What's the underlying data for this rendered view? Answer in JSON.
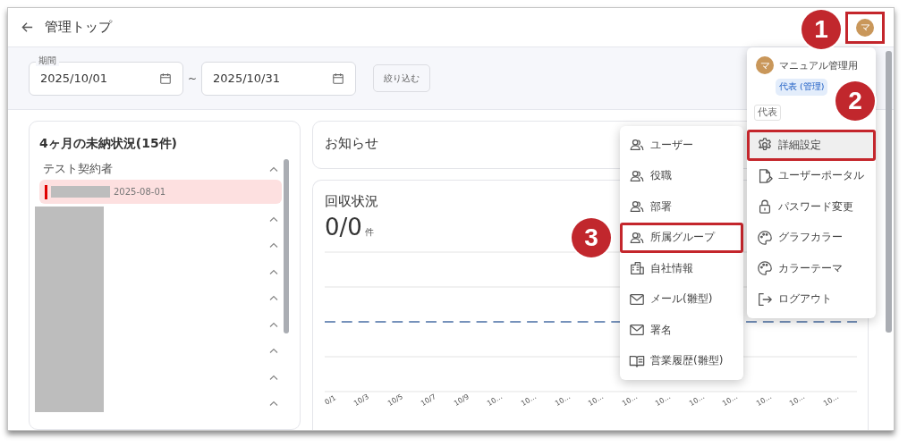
{
  "header": {
    "title": "管理トップ",
    "avatar_initial": "マ",
    "avatar_annotated": true
  },
  "filter": {
    "period_label": "期間",
    "start_date": "2025/10/01",
    "separator": "~",
    "end_date": "2025/10/31",
    "filter_button": "絞り込む"
  },
  "overdue_card": {
    "title": "4ヶ月の未納状況(15件)",
    "groups": [
      {
        "name": "テスト契約者",
        "expanded": true,
        "entries": [
          {
            "date": "2025-08-01",
            "flagged": true
          }
        ]
      }
    ],
    "hidden_groups": [
      {
        "expanded": true
      },
      {
        "expanded": true
      },
      {
        "expanded": true
      },
      {
        "expanded": true
      },
      {
        "expanded": true
      },
      {
        "expanded": true
      },
      {
        "expanded": true
      },
      {
        "expanded": true
      }
    ]
  },
  "notice_card": {
    "title": "お知らせ"
  },
  "collection_card": {
    "title": "回収状況",
    "value": "0/0",
    "unit": "件",
    "x_labels": [
      "0/1",
      "10/3",
      "10/5",
      "10/7",
      "10/9",
      "10…",
      "10…",
      "10…",
      "10…",
      "10…",
      "10…",
      "10…",
      "10…",
      "10…",
      "10…",
      "10…"
    ]
  },
  "submenu": {
    "items": [
      {
        "label": "ユーザー",
        "kind": "people",
        "annotated": false
      },
      {
        "label": "役職",
        "kind": "people",
        "annotated": false
      },
      {
        "label": "部署",
        "kind": "people",
        "annotated": false
      },
      {
        "label": "所属グループ",
        "kind": "people",
        "annotated": true
      },
      {
        "label": "自社情報",
        "kind": "building",
        "annotated": false
      },
      {
        "label": "メール(雛型)",
        "kind": "mail",
        "annotated": false
      },
      {
        "label": "署名",
        "kind": "mail",
        "annotated": false
      },
      {
        "label": "営業履歴(雛型)",
        "kind": "book",
        "annotated": false
      }
    ]
  },
  "user_menu": {
    "avatar_initial": "マ",
    "name": "マニュアル管理用",
    "role_chip": "代表 (管理)",
    "role_select": "代表",
    "items": [
      {
        "label": "詳細設定",
        "kind": "gear",
        "selected": true,
        "annotated": true
      },
      {
        "label": "ユーザーポータル",
        "kind": "document",
        "selected": false,
        "annotated": false
      },
      {
        "label": "パスワード変更",
        "kind": "lock",
        "selected": false,
        "annotated": false
      },
      {
        "label": "グラフカラー",
        "kind": "palette",
        "selected": false,
        "annotated": false
      },
      {
        "label": "カラーテーマ",
        "kind": "palette",
        "selected": false,
        "annotated": false
      },
      {
        "label": "ログアウト",
        "kind": "logout",
        "selected": false,
        "annotated": false
      }
    ]
  },
  "callouts": [
    {
      "number": "1"
    },
    {
      "number": "2"
    },
    {
      "number": "3"
    }
  ]
}
